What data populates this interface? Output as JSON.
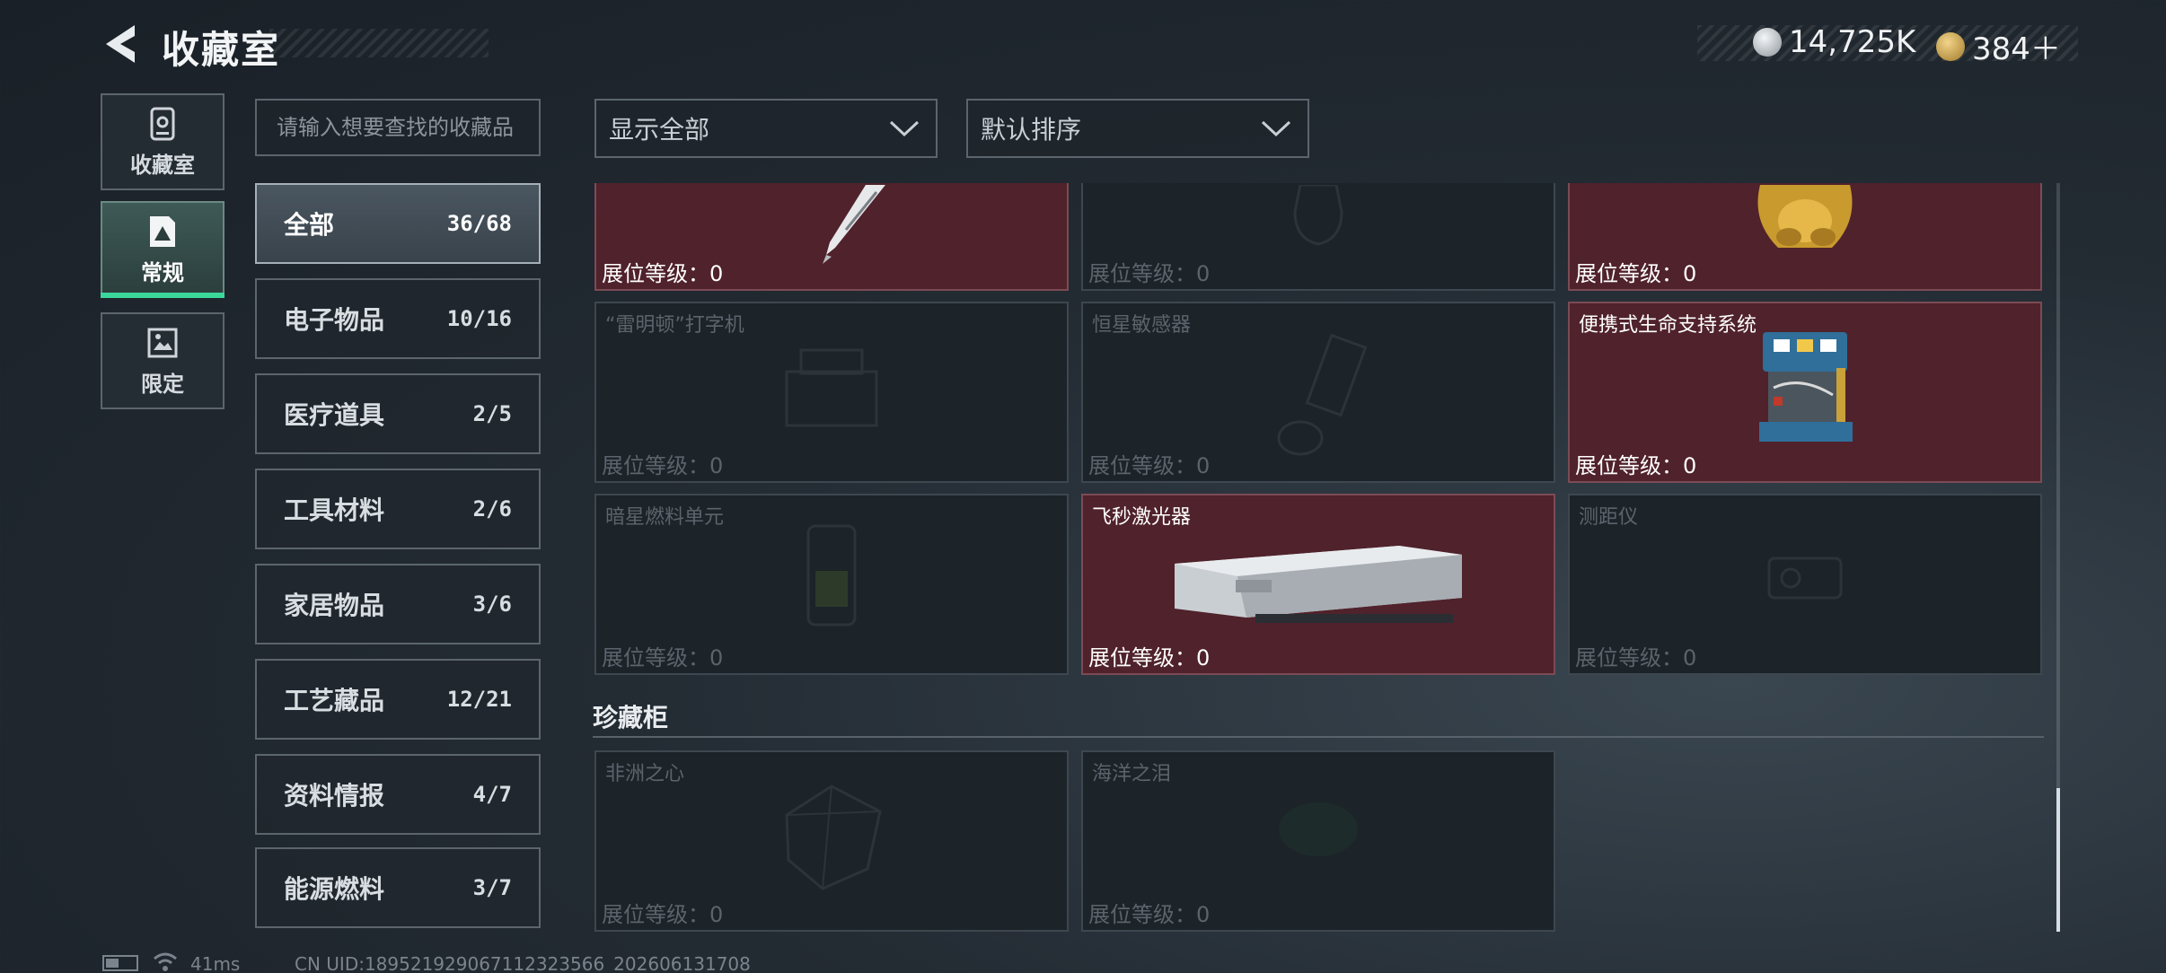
{
  "header": {
    "title": "收藏室",
    "currency_1": "14,725K",
    "currency_2": "384＋",
    "currency_1_icon": "silver-coin-icon",
    "currency_2_icon": "gold-triangle-coin-icon"
  },
  "left_tabs": [
    {
      "label": "收藏室",
      "icon": "collection-room-icon"
    },
    {
      "label": "常规",
      "icon": "regular-card-icon",
      "active": true
    },
    {
      "label": "限定",
      "icon": "limited-image-icon"
    }
  ],
  "search": {
    "placeholder": "请输入想要查找的收藏品"
  },
  "categories": [
    {
      "name": "全部",
      "count": "36/68",
      "active": true
    },
    {
      "name": "电子物品",
      "count": "10/16"
    },
    {
      "name": "医疗道具",
      "count": "2/5"
    },
    {
      "name": "工具材料",
      "count": "2/6"
    },
    {
      "name": "家居物品",
      "count": "3/6"
    },
    {
      "name": "工艺藏品",
      "count": "12/21"
    },
    {
      "name": "资料情报",
      "count": "4/7"
    },
    {
      "name": "能源燃料",
      "count": "3/7"
    }
  ],
  "filters": {
    "display": "显示全部",
    "sort": "默认排序"
  },
  "items": [
    {
      "name": "",
      "level": "展位等级：0",
      "owned": true,
      "art": "fountain-pen"
    },
    {
      "name": "",
      "level": "展位等级：0",
      "owned": false,
      "art": "vase"
    },
    {
      "name": "",
      "level": "展位等级：0",
      "owned": true,
      "art": "gold-statue"
    },
    {
      "name": "“雷明顿”打字机",
      "level": "展位等级：0",
      "owned": false,
      "art": "typewriter"
    },
    {
      "name": "恒星敏感器",
      "level": "展位等级：0",
      "owned": false,
      "art": "star-sensor"
    },
    {
      "name": "便携式生命支持系统",
      "level": "展位等级：0",
      "owned": true,
      "art": "life-support"
    },
    {
      "name": "暗星燃料单元",
      "level": "展位等级：0",
      "owned": false,
      "art": "fuel-cell"
    },
    {
      "name": "飞秒激光器",
      "level": "展位等级：0",
      "owned": true,
      "art": "laser-box"
    },
    {
      "name": "测距仪",
      "level": "展位等级：0",
      "owned": false,
      "art": "rangefinder"
    }
  ],
  "treasure_section": {
    "title": "珍藏柜",
    "items": [
      {
        "name": "非洲之心",
        "level": "展位等级：0",
        "owned": false,
        "art": "diamond"
      },
      {
        "name": "海洋之泪",
        "level": "展位等级：0",
        "owned": false,
        "art": "gem"
      }
    ]
  },
  "footer": {
    "ping": "41ms",
    "uid": "CN UID:18952192906711232356​6_202606131708"
  },
  "colors": {
    "owned_card": "#50222b",
    "active_tab_indicator": "#3ad89a"
  }
}
